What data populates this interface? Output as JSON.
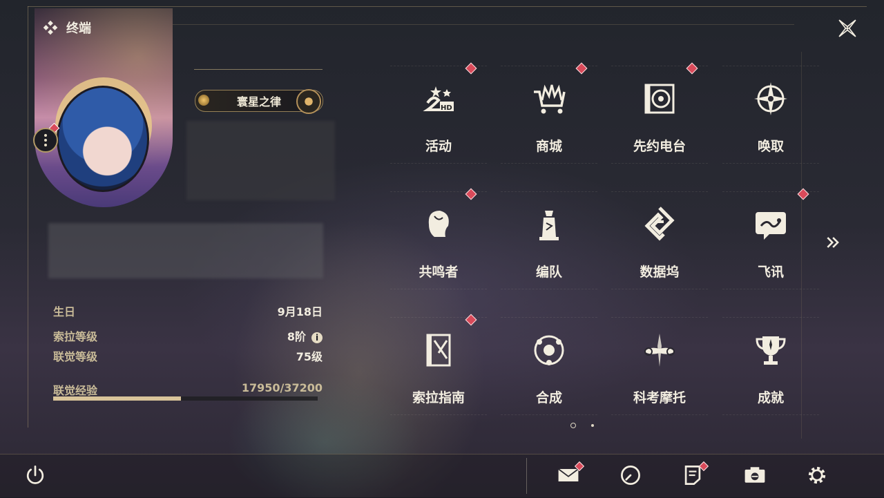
{
  "header": {
    "title": "终端"
  },
  "profile": {
    "title_badge": "寰星之律",
    "stats": [
      {
        "label": "生日",
        "value": "9月18日"
      },
      {
        "label": "索拉等级",
        "value": "8阶"
      },
      {
        "label": "联觉等级",
        "value": "75级"
      },
      {
        "label": "联觉经验",
        "value": "17950/37200"
      }
    ],
    "exp_progress": 0.483
  },
  "menu": {
    "items": [
      {
        "label": "活动",
        "icon": "event-2hd-icon",
        "badge": true
      },
      {
        "label": "商城",
        "icon": "shop-cart-icon",
        "badge": true
      },
      {
        "label": "先约电台",
        "icon": "radio-player-icon",
        "badge": true
      },
      {
        "label": "唤取",
        "icon": "compass-star-icon",
        "badge": false
      },
      {
        "label": "共鸣者",
        "icon": "resonator-head-icon",
        "badge": true
      },
      {
        "label": "编队",
        "icon": "team-chess-icon",
        "badge": false
      },
      {
        "label": "数据坞",
        "icon": "data-bank-icon",
        "badge": false
      },
      {
        "label": "飞讯",
        "icon": "message-chat-icon",
        "badge": true
      },
      {
        "label": "索拉指南",
        "icon": "guide-book-icon",
        "badge": true
      },
      {
        "label": "合成",
        "icon": "synthesis-orbit-icon",
        "badge": false
      },
      {
        "label": "科考摩托",
        "icon": "motorbike-icon",
        "badge": false
      },
      {
        "label": "成就",
        "icon": "trophy-icon",
        "badge": false
      }
    ],
    "pages": 2,
    "current_page": 1
  },
  "bottom_bar": {
    "buttons": [
      {
        "icon": "power-icon",
        "badge": false
      },
      {
        "icon": "mail-icon",
        "badge": true
      },
      {
        "icon": "clock-icon",
        "badge": false
      },
      {
        "icon": "notice-icon",
        "badge": true
      },
      {
        "icon": "camera-icon",
        "badge": false
      },
      {
        "icon": "gear-icon",
        "badge": false
      }
    ]
  },
  "colors": {
    "accent_gold": "#c9bb98",
    "badge_red": "#d94a5a",
    "text_light": "#f2ede0"
  }
}
